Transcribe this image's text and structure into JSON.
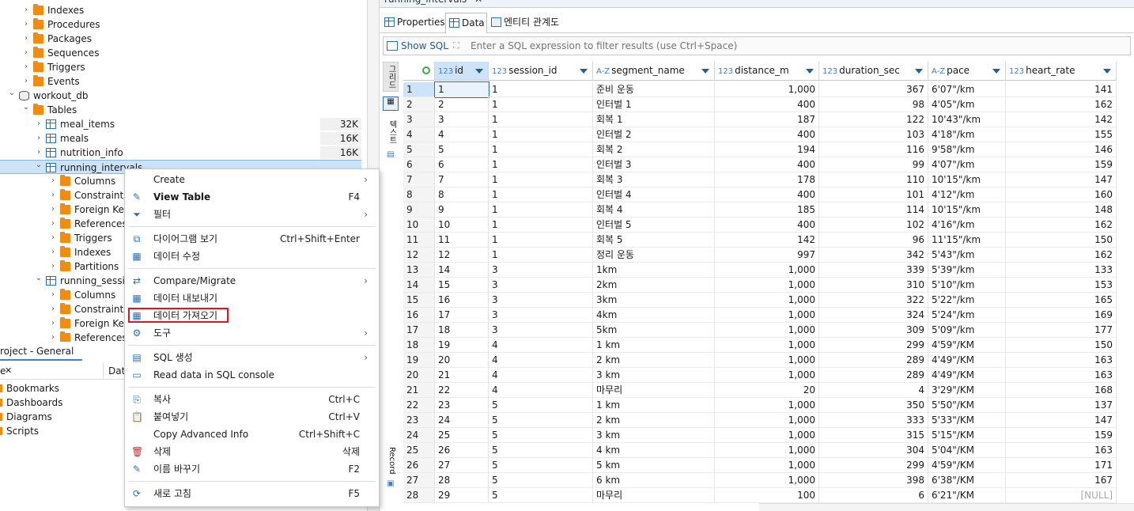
{
  "tree": {
    "items": [
      {
        "label": "Indexes",
        "kind": "folder",
        "level": 1
      },
      {
        "label": "Procedures",
        "kind": "folder",
        "level": 1
      },
      {
        "label": "Packages",
        "kind": "folder",
        "level": 1
      },
      {
        "label": "Sequences",
        "kind": "folder",
        "level": 1
      },
      {
        "label": "Triggers",
        "kind": "folder",
        "level": 1
      },
      {
        "label": "Events",
        "kind": "folder",
        "level": 1
      },
      {
        "label": "workout_db",
        "kind": "db",
        "level": 0
      },
      {
        "label": "Tables",
        "kind": "folder",
        "level": 1
      },
      {
        "label": "meal_items",
        "kind": "table",
        "level": 2,
        "size": "32K"
      },
      {
        "label": "meals",
        "kind": "table",
        "level": 2,
        "size": "16K"
      },
      {
        "label": "nutrition_info",
        "kind": "table",
        "level": 2,
        "size": "16K"
      },
      {
        "label": "running_intervals",
        "kind": "table",
        "level": 2,
        "size": ""
      },
      {
        "label": "Columns",
        "kind": "folder",
        "level": 3
      },
      {
        "label": "Constraints",
        "kind": "folder",
        "level": 3
      },
      {
        "label": "Foreign Keys",
        "kind": "folder",
        "level": 3
      },
      {
        "label": "References",
        "kind": "folder",
        "level": 3
      },
      {
        "label": "Triggers",
        "kind": "folder",
        "level": 3
      },
      {
        "label": "Indexes",
        "kind": "folder",
        "level": 3
      },
      {
        "label": "Partitions",
        "kind": "folder",
        "level": 3
      },
      {
        "label": "running_session",
        "kind": "table",
        "level": 2,
        "size": ""
      },
      {
        "label": "Columns",
        "kind": "folder",
        "level": 3
      },
      {
        "label": "Constraints",
        "kind": "folder",
        "level": 3
      },
      {
        "label": "Foreign Keys",
        "kind": "folder",
        "level": 3
      },
      {
        "label": "References",
        "kind": "folder",
        "level": 3
      }
    ]
  },
  "project": {
    "tab": "roject - General",
    "close": "✕",
    "col1": "e",
    "col2": "Dat",
    "items": [
      "Bookmarks",
      "Dashboards",
      "Diagrams",
      "Scripts"
    ]
  },
  "editor": {
    "tab_title": "running_intervals",
    "tab_close": "✕",
    "subtabs": [
      "Properties",
      "Data",
      "엔티티 관계도"
    ],
    "show_sql": "Show SQL",
    "filter_placeholder": "Enter a SQL expression to filter results (use Ctrl+Space)",
    "sidebar": {
      "grid": "그리드",
      "text": "텍스트",
      "record": "Record"
    }
  },
  "grid": {
    "columns": [
      {
        "type": "123",
        "name": "id"
      },
      {
        "type": "123",
        "name": "session_id"
      },
      {
        "type": "A-Z",
        "name": "segment_name"
      },
      {
        "type": "123",
        "name": "distance_m"
      },
      {
        "type": "123",
        "name": "duration_sec"
      },
      {
        "type": "A-Z",
        "name": "pace"
      },
      {
        "type": "123",
        "name": "heart_rate"
      }
    ],
    "rows": [
      [
        "1",
        "1",
        "1",
        "준비 운동",
        "1,000",
        "367",
        "6'07\"/km",
        "141"
      ],
      [
        "2",
        "2",
        "1",
        "인터벌 1",
        "400",
        "98",
        "4'05\"/km",
        "162"
      ],
      [
        "3",
        "3",
        "1",
        "회복 1",
        "187",
        "122",
        "10'43\"/km",
        "142"
      ],
      [
        "4",
        "4",
        "1",
        "인터벌 2",
        "400",
        "103",
        "4'18\"/km",
        "155"
      ],
      [
        "5",
        "5",
        "1",
        "회복 2",
        "194",
        "116",
        "9'58\"/km",
        "146"
      ],
      [
        "6",
        "6",
        "1",
        "인터벌 3",
        "400",
        "99",
        "4'07\"/km",
        "159"
      ],
      [
        "7",
        "7",
        "1",
        "회복 3",
        "178",
        "110",
        "10'15\"/km",
        "147"
      ],
      [
        "8",
        "8",
        "1",
        "인터벌 4",
        "400",
        "101",
        "4'12\"/km",
        "160"
      ],
      [
        "9",
        "9",
        "1",
        "회복 4",
        "185",
        "114",
        "10'15\"/km",
        "148"
      ],
      [
        "10",
        "10",
        "1",
        "인터벌 5",
        "400",
        "102",
        "4'16\"/km",
        "162"
      ],
      [
        "11",
        "11",
        "1",
        "회복 5",
        "142",
        "96",
        "11'15\"/km",
        "150"
      ],
      [
        "12",
        "12",
        "1",
        "정리 운동",
        "997",
        "342",
        "5'43\"/km",
        "162"
      ],
      [
        "13",
        "14",
        "3",
        "1km",
        "1,000",
        "339",
        "5'39\"/km",
        "133"
      ],
      [
        "14",
        "15",
        "3",
        "2km",
        "1,000",
        "310",
        "5'10\"/km",
        "153"
      ],
      [
        "15",
        "16",
        "3",
        "3km",
        "1,000",
        "322",
        "5'22\"/km",
        "165"
      ],
      [
        "16",
        "17",
        "3",
        "4km",
        "1,000",
        "324",
        "5'24\"/km",
        "169"
      ],
      [
        "17",
        "18",
        "3",
        "5km",
        "1,000",
        "309",
        "5'09\"/km",
        "177"
      ],
      [
        "18",
        "19",
        "4",
        "1 km",
        "1,000",
        "299",
        "4'59\"/KM",
        "150"
      ],
      [
        "19",
        "20",
        "4",
        "2 km",
        "1,000",
        "289",
        "4'49\"/KM",
        "163"
      ],
      [
        "20",
        "21",
        "4",
        "3 km",
        "1,000",
        "289",
        "4'49\"/KM",
        "163"
      ],
      [
        "21",
        "22",
        "4",
        "마무리",
        "20",
        "4",
        "3'29\"/KM",
        "168"
      ],
      [
        "22",
        "23",
        "5",
        "1 km",
        "1,000",
        "350",
        "5'50\"/KM",
        "137"
      ],
      [
        "23",
        "24",
        "5",
        "2 km",
        "1,000",
        "333",
        "5'33\"/KM",
        "147"
      ],
      [
        "24",
        "25",
        "5",
        "3 km",
        "1,000",
        "315",
        "5'15\"/KM",
        "159"
      ],
      [
        "25",
        "26",
        "5",
        "4 km",
        "1,000",
        "304",
        "5'04\"/KM",
        "163"
      ],
      [
        "26",
        "27",
        "5",
        "5 km",
        "1,000",
        "299",
        "4'59\"/KM",
        "171"
      ],
      [
        "27",
        "28",
        "5",
        "6 km",
        "1,000",
        "398",
        "6'38\"/KM",
        "167"
      ],
      [
        "28",
        "29",
        "5",
        "마무리",
        "100",
        "6",
        "6'21\"/KM",
        "[NULL]"
      ]
    ]
  },
  "menu": {
    "items": [
      {
        "label": "Create",
        "shortcut": "",
        "arrow": true,
        "icon": "",
        "bold": false,
        "sep_after": false
      },
      {
        "label": "View Table",
        "shortcut": "F4",
        "arrow": false,
        "icon": "pencil-icon",
        "bold": true,
        "sep_after": false
      },
      {
        "label": "필터",
        "shortcut": "",
        "arrow": true,
        "icon": "filter-icon",
        "bold": false,
        "sep_after": true
      },
      {
        "label": "다이어그램 보기",
        "shortcut": "Ctrl+Shift+Enter",
        "arrow": false,
        "icon": "diagram-icon",
        "bold": false,
        "sep_after": false
      },
      {
        "label": "데이터 수정",
        "shortcut": "",
        "arrow": false,
        "icon": "table-edit-icon",
        "bold": false,
        "sep_after": true
      },
      {
        "label": "Compare/Migrate",
        "shortcut": "",
        "arrow": true,
        "icon": "compare-icon",
        "bold": false,
        "sep_after": false
      },
      {
        "label": "데이터 내보내기",
        "shortcut": "",
        "arrow": false,
        "icon": "export-icon",
        "bold": false,
        "sep_after": false
      },
      {
        "label": "데이터 가져오기",
        "shortcut": "",
        "arrow": false,
        "icon": "import-icon",
        "bold": false,
        "sep_after": false,
        "highlight": true
      },
      {
        "label": "도구",
        "shortcut": "",
        "arrow": true,
        "icon": "tools-icon",
        "bold": false,
        "sep_after": true
      },
      {
        "label": "SQL 생성",
        "shortcut": "",
        "arrow": true,
        "icon": "sql-icon",
        "bold": false,
        "sep_after": false
      },
      {
        "label": "Read data in SQL console",
        "shortcut": "",
        "arrow": false,
        "icon": "console-icon",
        "bold": false,
        "sep_after": true
      },
      {
        "label": "복사",
        "shortcut": "Ctrl+C",
        "arrow": false,
        "icon": "copy-icon",
        "bold": false,
        "sep_after": false
      },
      {
        "label": "붙여넣기",
        "shortcut": "Ctrl+V",
        "arrow": false,
        "icon": "paste-icon",
        "bold": false,
        "sep_after": false
      },
      {
        "label": "Copy Advanced Info",
        "shortcut": "Ctrl+Shift+C",
        "arrow": false,
        "icon": "",
        "bold": false,
        "sep_after": false
      },
      {
        "label": "삭제",
        "shortcut": "삭제",
        "arrow": false,
        "icon": "delete-icon",
        "bold": false,
        "sep_after": false
      },
      {
        "label": "이름 바꾸기",
        "shortcut": "F2",
        "arrow": false,
        "icon": "rename-icon",
        "bold": false,
        "sep_after": true
      },
      {
        "label": "새로 고침",
        "shortcut": "F5",
        "arrow": false,
        "icon": "refresh-icon",
        "bold": false,
        "sep_after": false
      }
    ]
  },
  "colors": {
    "accent": "#3b7fd6",
    "highlight": "#e0161b",
    "folder": "#f08c10",
    "selection": "#cde3f8"
  }
}
